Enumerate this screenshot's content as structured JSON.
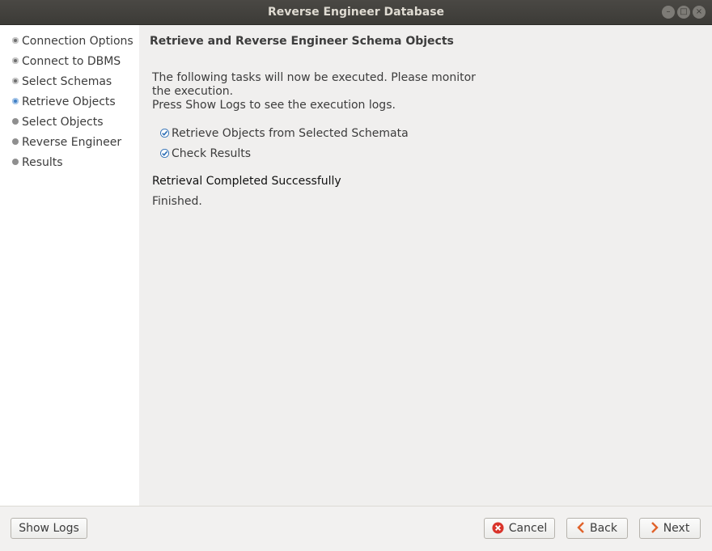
{
  "window": {
    "title": "Reverse Engineer Database"
  },
  "sidebar": {
    "steps": [
      {
        "label": "Connection Options",
        "state": "done"
      },
      {
        "label": "Connect to DBMS",
        "state": "done"
      },
      {
        "label": "Select Schemas",
        "state": "done"
      },
      {
        "label": "Retrieve Objects",
        "state": "current"
      },
      {
        "label": "Select Objects",
        "state": "pending"
      },
      {
        "label": "Reverse Engineer",
        "state": "pending"
      },
      {
        "label": "Results",
        "state": "pending"
      }
    ]
  },
  "main": {
    "heading": "Retrieve and Reverse Engineer Schema Objects",
    "description_lines": [
      "The following tasks will now be executed. Please monitor",
      "the execution.",
      "Press Show Logs to see the execution logs."
    ],
    "tasks": [
      {
        "label": "Retrieve Objects from Selected Schemata",
        "checked": true
      },
      {
        "label": "Check Results",
        "checked": true
      }
    ],
    "status": "Retrieval Completed Successfully",
    "finished": "Finished."
  },
  "footer": {
    "show_logs": "Show Logs",
    "cancel": "Cancel",
    "back": "Back",
    "next": "Next"
  },
  "colors": {
    "current_step": "#3f7fc4",
    "cancel_icon": "#d9342b",
    "nav_icon": "#e0622a",
    "check": "#2f6fb5"
  }
}
